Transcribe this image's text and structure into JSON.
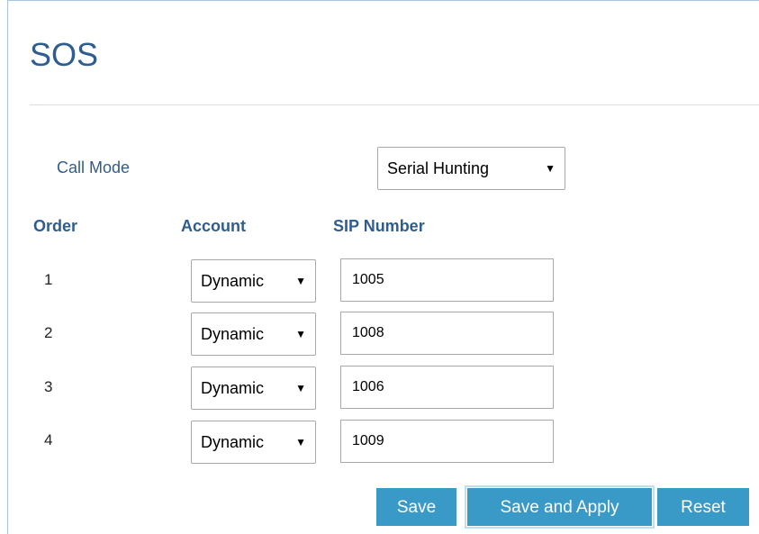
{
  "page": {
    "title": "SOS"
  },
  "call_mode": {
    "label": "Call Mode",
    "selected": "Serial Hunting"
  },
  "table": {
    "headers": {
      "order": "Order",
      "account": "Account",
      "sip_number": "SIP Number"
    },
    "rows": [
      {
        "order": "1",
        "account": "Dynamic",
        "sip_number": "1005"
      },
      {
        "order": "2",
        "account": "Dynamic",
        "sip_number": "1008"
      },
      {
        "order": "3",
        "account": "Dynamic",
        "sip_number": "1006"
      },
      {
        "order": "4",
        "account": "Dynamic",
        "sip_number": "1009"
      }
    ]
  },
  "buttons": {
    "save": "Save",
    "save_and_apply": "Save and Apply",
    "reset": "Reset"
  },
  "icons": {
    "dropdown": "caret-down-icon"
  },
  "colors": {
    "heading": "#2f5d8f",
    "button": "#3a9ac7",
    "frame_border": "#a9c4e6"
  }
}
